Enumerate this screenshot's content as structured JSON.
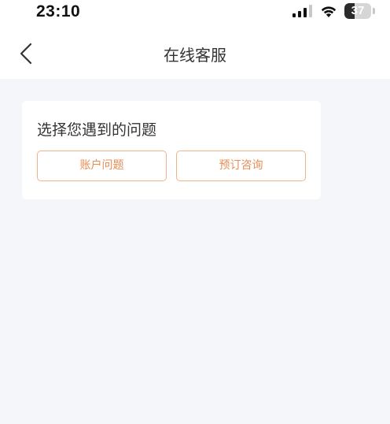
{
  "status_bar": {
    "time": "23:10",
    "battery_percent": 37,
    "battery_label": "37",
    "signal_icon": "cellular-signal-icon",
    "wifi_icon": "wifi-icon"
  },
  "nav": {
    "back_icon": "chevron-left-icon",
    "title": "在线客服"
  },
  "card": {
    "title": "选择您遇到的问题",
    "options": [
      {
        "label": "账户问题"
      },
      {
        "label": "预订咨询"
      }
    ]
  },
  "colors": {
    "accent": "#e88d55",
    "accent_border": "#f0b48a",
    "page_background": "#f5f6fa",
    "card_background": "#ffffff"
  }
}
